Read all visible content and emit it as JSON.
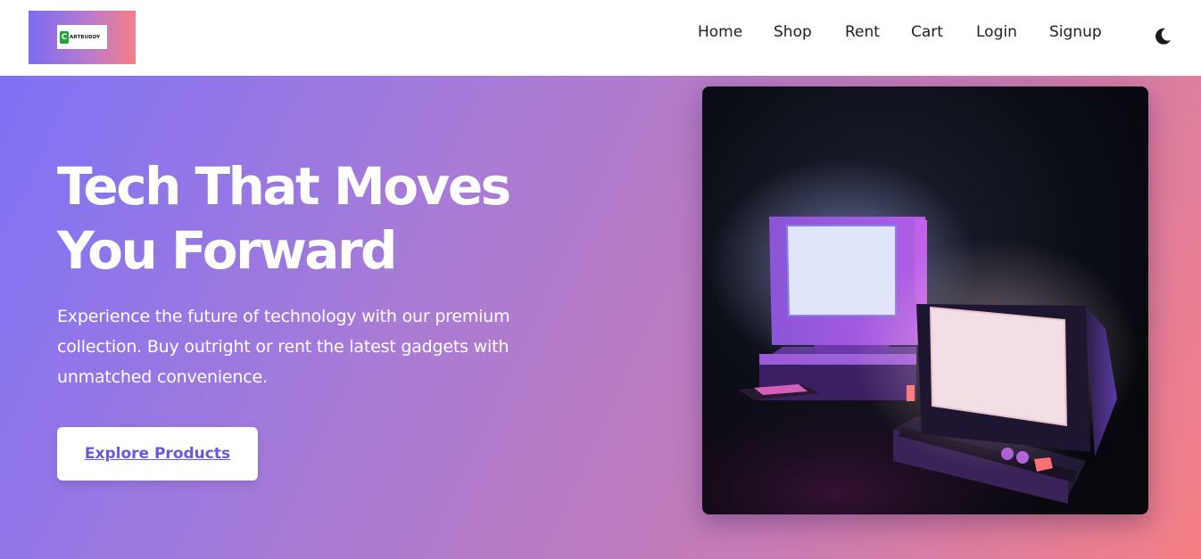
{
  "brand": {
    "logo_text": "ARTBUDDY",
    "logo_mark": "C"
  },
  "nav": {
    "items": [
      {
        "label": "Home"
      },
      {
        "label": "Shop"
      },
      {
        "label": "Rent"
      },
      {
        "label": "Cart"
      },
      {
        "label": "Login"
      },
      {
        "label": "Signup"
      }
    ],
    "theme_toggle_icon": "moon-icon"
  },
  "hero": {
    "title_line1": "Tech That Moves",
    "title_line2": "You Forward",
    "description": "Experience the future of technology with our premium collection. Buy outright or rent the latest gadgets with unmatched convenience.",
    "cta_label": "Explore Products",
    "image_subject": "retro-computers-illustration"
  },
  "colors": {
    "gradient_start": "#7f72f5",
    "gradient_end": "#f67f84",
    "cta_text": "#6a57e0",
    "nav_text": "#1f1f1f"
  }
}
